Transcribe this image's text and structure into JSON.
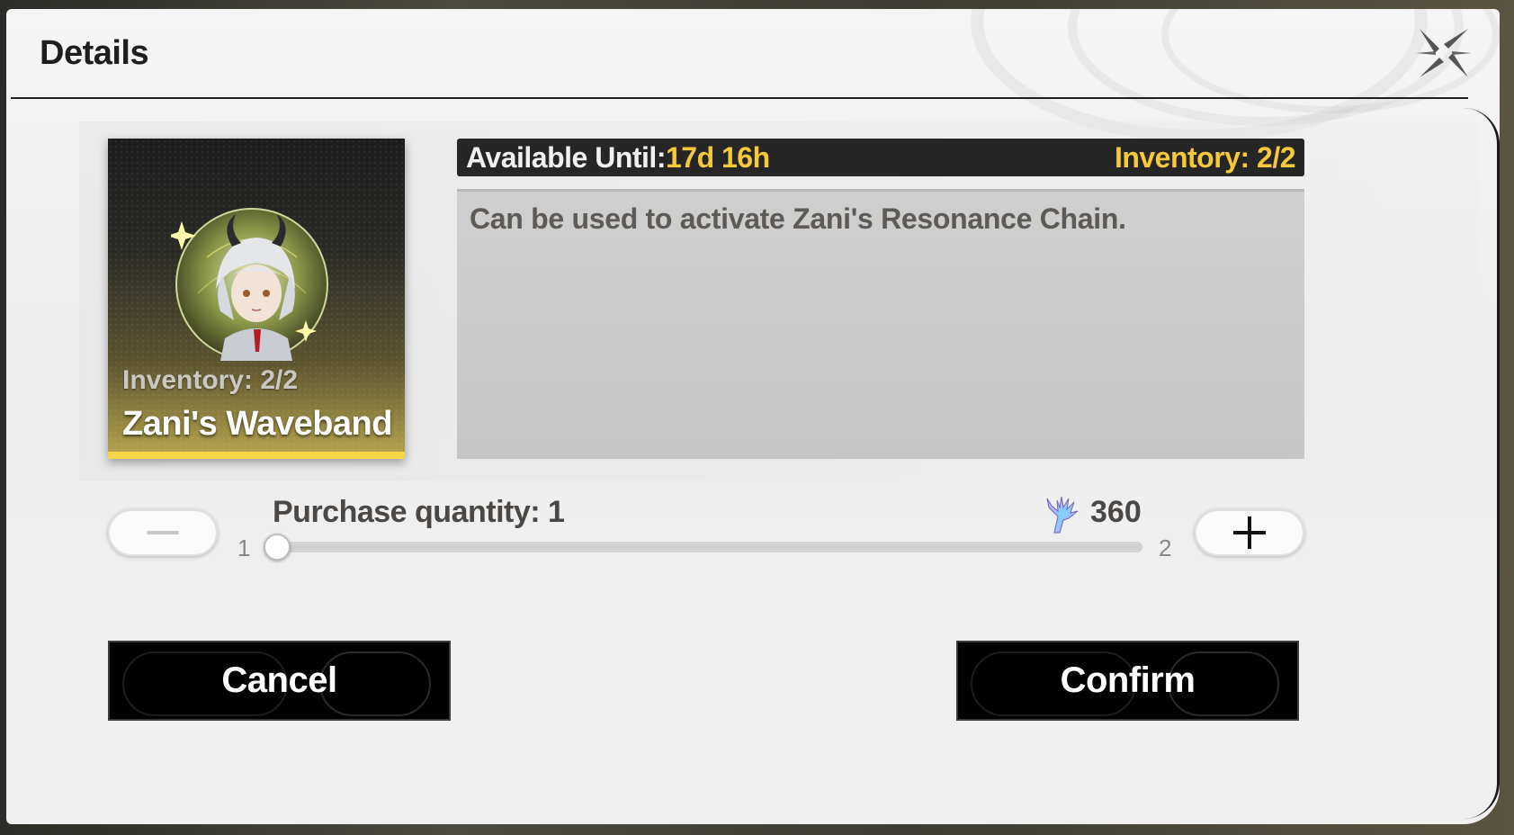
{
  "dialog": {
    "title": "Details",
    "close_icon": "close-x-icon"
  },
  "item": {
    "name": "Zani's Waveband",
    "card_inventory": "Inventory: 2/2",
    "portrait_icon": "character-portrait-icon",
    "accent_color": "#f5d54a"
  },
  "info": {
    "available_label": "Available Until:",
    "available_value": "17d 16h",
    "inventory": "Inventory: 2/2",
    "highlight_color": "#f5c93a"
  },
  "description": "Can be used to activate Zani's Resonance Chain.",
  "purchase": {
    "quantity_label": "Purchase quantity: 1",
    "price": "360",
    "currency_icon": "coral-currency-icon",
    "slider_min": "1",
    "slider_max": "2",
    "slider_value_fraction": 0
  },
  "buttons": {
    "minus_icon": "minus-icon",
    "plus_icon": "plus-icon",
    "cancel": "Cancel",
    "confirm": "Confirm"
  }
}
